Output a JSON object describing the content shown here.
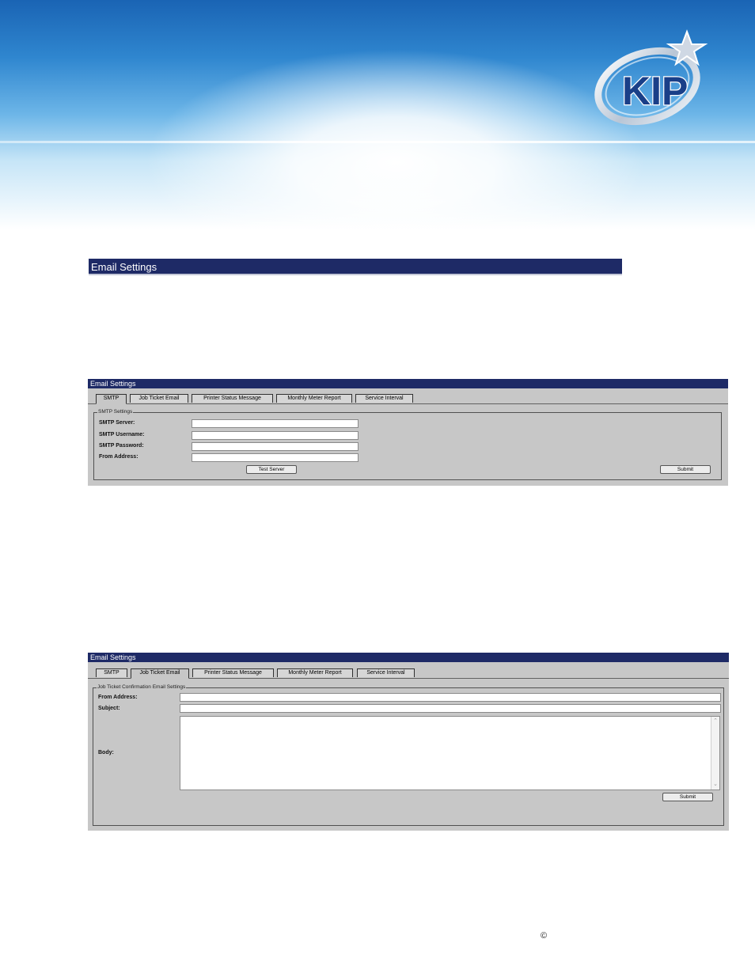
{
  "header": {
    "logo_text": "KIP"
  },
  "section": {
    "heading": "Email Settings"
  },
  "smtp_panel": {
    "title": "Email Settings",
    "tabs": [
      "SMTP",
      "Job Ticket Email",
      "Printer Status Message",
      "Monthly Meter Report",
      "Service Interval"
    ],
    "active_tab": "SMTP",
    "legend": "SMTP Settings",
    "fields": [
      {
        "label": "SMTP Server:",
        "value": ""
      },
      {
        "label": "SMTP Username:",
        "value": ""
      },
      {
        "label": "SMTP Password:",
        "value": ""
      },
      {
        "label": "From Address:",
        "value": ""
      }
    ],
    "test_button": "Test Server",
    "submit_button": "Submit"
  },
  "job_ticket_panel": {
    "title": "Email Settings",
    "tabs": [
      "SMTP",
      "Job Ticket Email",
      "Printer Status Message",
      "Monthly Meter Report",
      "Service Interval"
    ],
    "active_tab": "Job Ticket Email",
    "legend": "Job Ticket Confirmation Email Settings",
    "fields": [
      {
        "label": "From Address:",
        "value": ""
      },
      {
        "label": "Subject:",
        "value": ""
      }
    ],
    "body_label": "Body:",
    "submit_button": "Submit"
  },
  "footer": {
    "copyright_symbol": "©"
  }
}
